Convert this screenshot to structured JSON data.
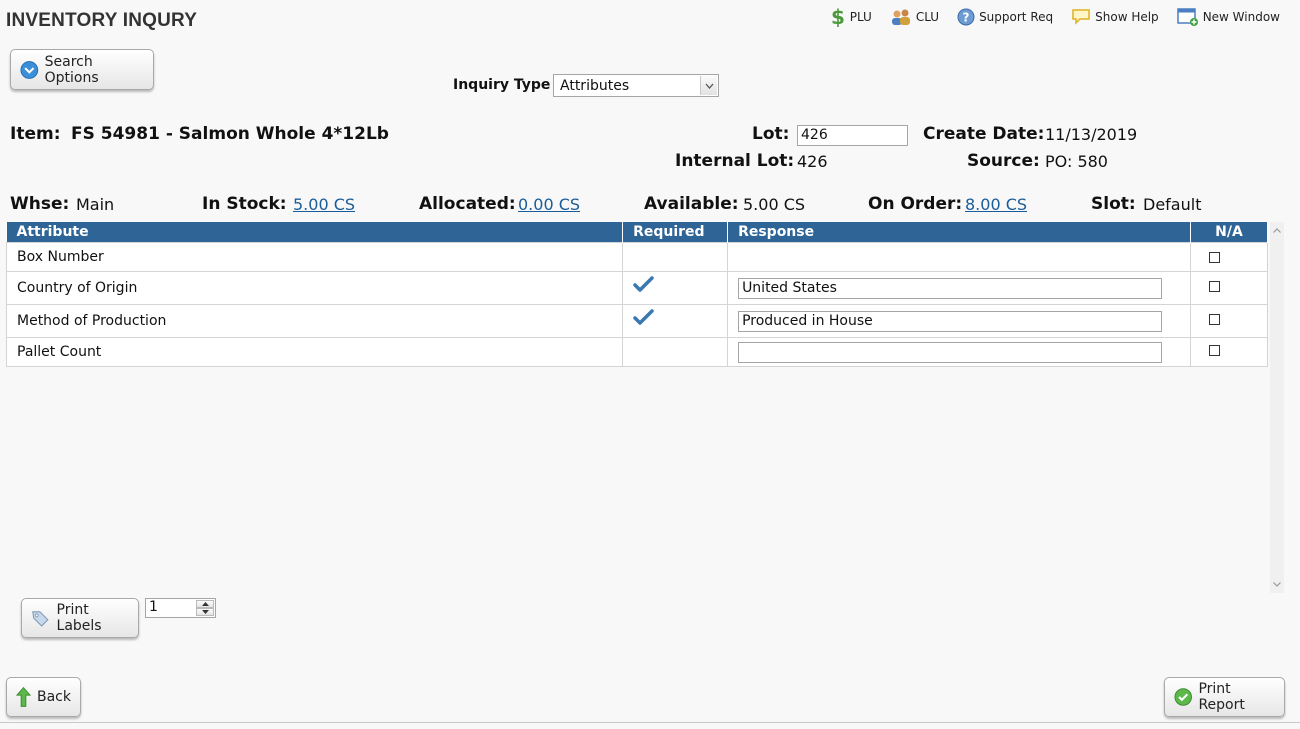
{
  "header": {
    "title": "INVENTORY INQURY",
    "links": [
      {
        "label": "PLU",
        "icon": "dollar-icon"
      },
      {
        "label": "CLU",
        "icon": "users-icon"
      },
      {
        "label": "Support Req",
        "icon": "help-circle-icon"
      },
      {
        "label": "Show Help",
        "icon": "speech-bubble-icon"
      },
      {
        "label": "New Window",
        "icon": "new-window-icon"
      }
    ]
  },
  "search_options_label": "Search Options",
  "inquiry": {
    "label": "Inquiry Type",
    "selected": "Attributes"
  },
  "item": {
    "label": "Item:",
    "value": "FS 54981 - Salmon Whole 4*12Lb"
  },
  "lot": {
    "label": "Lot:",
    "value": "426"
  },
  "internal_lot": {
    "label": "Internal Lot:",
    "value": "426"
  },
  "create_date": {
    "label": "Create Date:",
    "value": "11/13/2019"
  },
  "source": {
    "label": "Source:",
    "value": "PO: 580"
  },
  "stats": {
    "whse": {
      "label": "Whse:",
      "value": "Main"
    },
    "in_stock": {
      "label": "In Stock:",
      "value": "5.00 CS"
    },
    "allocated": {
      "label": "Allocated:",
      "value": "0.00 CS"
    },
    "available": {
      "label": "Available:",
      "value": "5.00 CS"
    },
    "on_order": {
      "label": "On Order:",
      "value": "8.00 CS"
    },
    "slot": {
      "label": "Slot:",
      "value": "Default"
    }
  },
  "table": {
    "headers": [
      "Attribute",
      "Required",
      "Response",
      "N/A"
    ],
    "rows": [
      {
        "attribute": "Box Number",
        "required": false,
        "response": null
      },
      {
        "attribute": "Country of Origin",
        "required": true,
        "response": "United States"
      },
      {
        "attribute": "Method of Production",
        "required": true,
        "response": "Produced in House"
      },
      {
        "attribute": "Pallet Count",
        "required": false,
        "response": ""
      }
    ]
  },
  "print_labels": {
    "label": "Print Labels",
    "quantity": "1"
  },
  "footer": {
    "back_label": "Back",
    "print_report_label": "Print Report"
  },
  "colors": {
    "header_blue": "#2f6496",
    "link_blue": "#1a5c9a",
    "check_blue": "#3a78b0"
  }
}
